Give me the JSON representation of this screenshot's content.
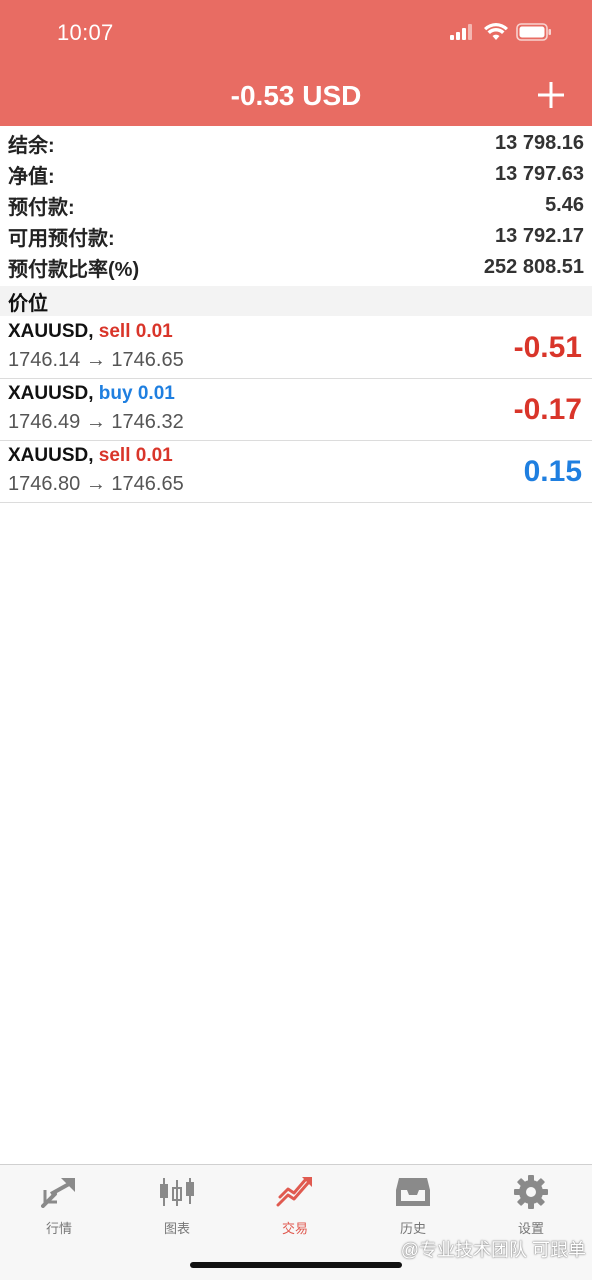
{
  "status_bar": {
    "time": "10:07"
  },
  "header": {
    "title": "-0.53 USD",
    "add_symbol": "+"
  },
  "summary": [
    {
      "label": "结余:",
      "value": "13 798.16"
    },
    {
      "label": "净值:",
      "value": "13 797.63"
    },
    {
      "label": "预付款:",
      "value": "5.46"
    },
    {
      "label": "可用预付款:",
      "value": "13 792.17"
    },
    {
      "label": "预付款比率(%)",
      "value": "252 808.51"
    }
  ],
  "section_title": "价位",
  "positions": [
    {
      "symbol": "XAUUSD,",
      "type": "sell 0.01",
      "prices": "1746.14 → 1746.65",
      "profit": "-0.51"
    },
    {
      "symbol": "XAUUSD,",
      "type": "buy 0.01",
      "prices": "1746.49 → 1746.32",
      "profit": "-0.17"
    },
    {
      "symbol": "XAUUSD,",
      "type": "sell 0.01",
      "prices": "1746.80 → 1746.65",
      "profit": "0.15"
    }
  ],
  "tabs": [
    {
      "label": "行情",
      "icon": "quotes-icon"
    },
    {
      "label": "图表",
      "icon": "chart-icon"
    },
    {
      "label": "交易",
      "icon": "trade-icon",
      "active": true
    },
    {
      "label": "历史",
      "icon": "history-icon"
    },
    {
      "label": "设置",
      "icon": "settings-icon"
    }
  ],
  "watermark": "@专业技术团队 可跟单",
  "colors": {
    "header": "#e86c63",
    "loss": "#d9352a",
    "buy_profit": "#1f7fe0"
  }
}
